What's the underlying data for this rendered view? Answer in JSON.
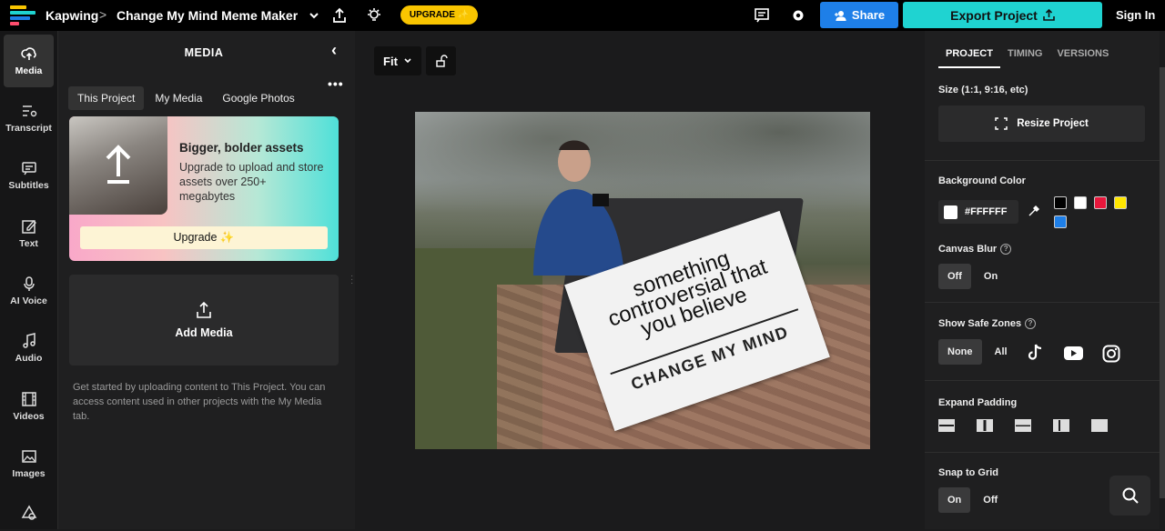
{
  "header": {
    "brand": "Kapwing",
    "separator": ">",
    "project_title": "Change My Mind Meme Maker",
    "upgrade_label": "UPGRADE ✨",
    "share_label": "Share",
    "export_label": "Export Project",
    "signin_label": "Sign In"
  },
  "leftnav": {
    "items": [
      {
        "label": "Media",
        "icon": "upload-cloud-icon"
      },
      {
        "label": "Transcript",
        "icon": "transcript-icon"
      },
      {
        "label": "Subtitles",
        "icon": "subtitles-icon"
      },
      {
        "label": "Text",
        "icon": "text-edit-icon"
      },
      {
        "label": "AI Voice",
        "icon": "microphone-icon"
      },
      {
        "label": "Audio",
        "icon": "music-note-icon"
      },
      {
        "label": "Videos",
        "icon": "film-icon"
      },
      {
        "label": "Images",
        "icon": "image-icon"
      }
    ]
  },
  "media": {
    "title": "MEDIA",
    "collapse": "‹",
    "more": "•••",
    "tabs": [
      "This Project",
      "My Media",
      "Google Photos"
    ],
    "promo": {
      "heading": "Bigger, bolder assets",
      "text": "Upgrade to upload and store assets over 250+ megabytes",
      "button": "Upgrade ✨"
    },
    "add_media": "Add Media",
    "helper": "Get started by uploading content to This Project. You can access content used in other projects with the My Media tab."
  },
  "canvas": {
    "fit_label": "Fit",
    "meme": {
      "sign_line1": "something",
      "sign_line2": "controversial that",
      "sign_line3": "you believe",
      "sign_footer": "CHANGE MY MIND"
    }
  },
  "right": {
    "tabs": [
      "PROJECT",
      "TIMING",
      "VERSIONS"
    ],
    "size_label": "Size (1:1, 9:16, etc)",
    "resize_label": "Resize Project",
    "bg_label": "Background Color",
    "bg_value": "#FFFFFF",
    "swatches": [
      "#000000",
      "#FFFFFF",
      "#E8173C",
      "#FFE600",
      "#1E7FE8"
    ],
    "blur_label": "Canvas Blur",
    "blur_off": "Off",
    "blur_on": "On",
    "safe_label": "Show Safe Zones",
    "safe_none": "None",
    "safe_all": "All",
    "padding_label": "Expand Padding",
    "snap_label": "Snap to Grid",
    "snap_on": "On",
    "snap_off": "Off",
    "help_glyph": "?"
  },
  "colors": {
    "accent_blue": "#1E7FE8",
    "accent_teal": "#1FD3D1",
    "upgrade_yellow": "#F9C500"
  }
}
